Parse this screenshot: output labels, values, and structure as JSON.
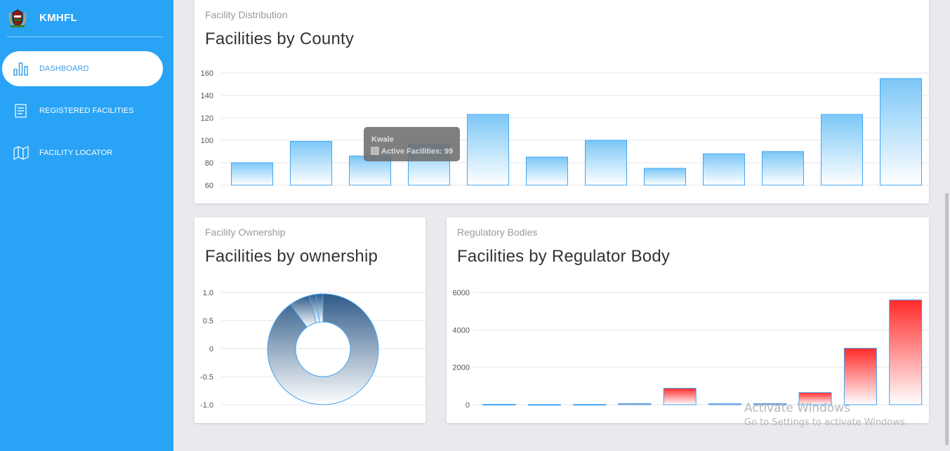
{
  "brand": {
    "name": "KMHFL",
    "logo_icon": "coat-of-arms-icon"
  },
  "nav": {
    "items": [
      {
        "label": "DASHBOARD",
        "icon": "bar-chart-icon",
        "active": true
      },
      {
        "label": "REGISTERED FACILITIES",
        "icon": "document-icon",
        "active": false
      },
      {
        "label": "FACILITY LOCATOR",
        "icon": "map-icon",
        "active": false
      }
    ]
  },
  "county_card": {
    "category": "Facility Distribution",
    "title": "Facilities by County"
  },
  "ownership_card": {
    "category": "Facility Ownership",
    "title": "Facilities by ownership"
  },
  "regulator_card": {
    "category": "Regulatory Bodies",
    "title": "Facilities by Regulator Body"
  },
  "tooltip": {
    "title": "Kwale",
    "label": "Active Facilities: 99"
  },
  "watermark": {
    "title": "Activate Windows",
    "subtitle": "Go to Settings to activate Windows."
  },
  "colors": {
    "sidebar": "#29a3f5",
    "bar_blue": "#7cc7f7",
    "bar_red": "#ff2a2a",
    "donut_dark": "#2e5a87"
  },
  "chart_data": [
    {
      "type": "bar",
      "ylim": [
        60,
        160
      ],
      "yticks": [
        "160",
        "140",
        "120",
        "100",
        "80",
        "60"
      ],
      "values": [
        80,
        99,
        86,
        96,
        123,
        85,
        100,
        75,
        88,
        90,
        123,
        155
      ]
    },
    {
      "type": "pie",
      "yticks": [
        "1.0",
        "0.5",
        "0",
        "-0.5",
        "-1.0"
      ],
      "values": [
        90,
        6,
        2,
        2
      ]
    },
    {
      "type": "bar",
      "ylim": [
        0,
        6000
      ],
      "yticks": [
        "6000",
        "4000",
        "2000",
        "0"
      ],
      "values": [
        20,
        10,
        15,
        60,
        880,
        50,
        60,
        650,
        3020,
        5600
      ]
    }
  ]
}
